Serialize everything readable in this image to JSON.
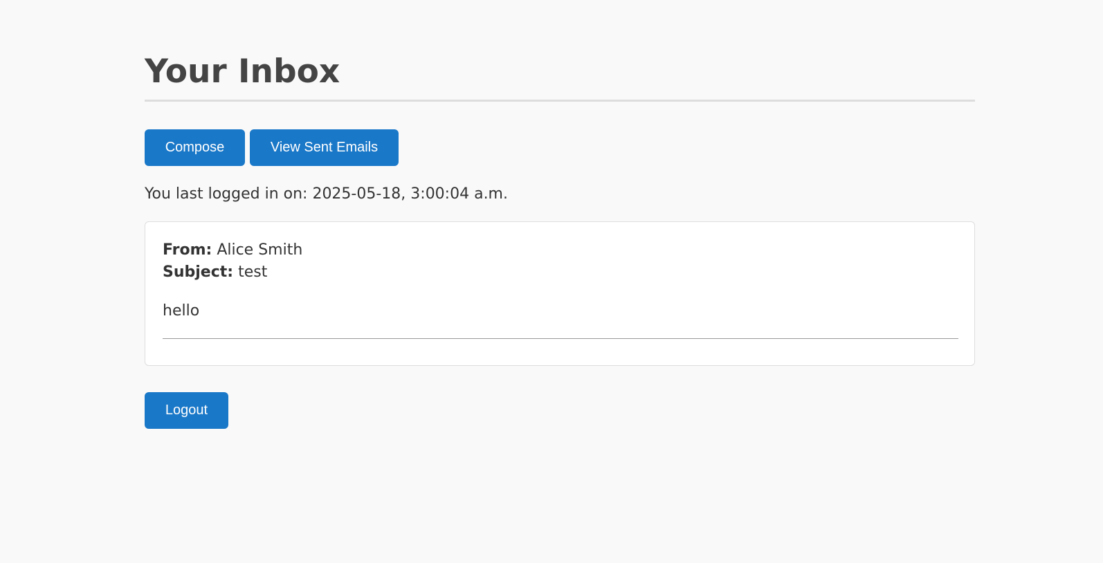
{
  "page": {
    "title": "Your Inbox"
  },
  "toolbar": {
    "compose_label": "Compose",
    "view_sent_label": "View Sent Emails"
  },
  "session": {
    "last_login_text": "You last logged in on: 2025-05-18, 3:00:04 a.m."
  },
  "emails": [
    {
      "from_label": "From:",
      "from": "Alice Smith",
      "subject_label": "Subject:",
      "subject": "test",
      "body": "hello"
    }
  ],
  "footer": {
    "logout_label": "Logout"
  },
  "colors": {
    "background": "#f9f9f9",
    "button": "#1a78c8",
    "button_text": "#ffffff",
    "title_text": "#444444",
    "body_text": "#333333"
  }
}
